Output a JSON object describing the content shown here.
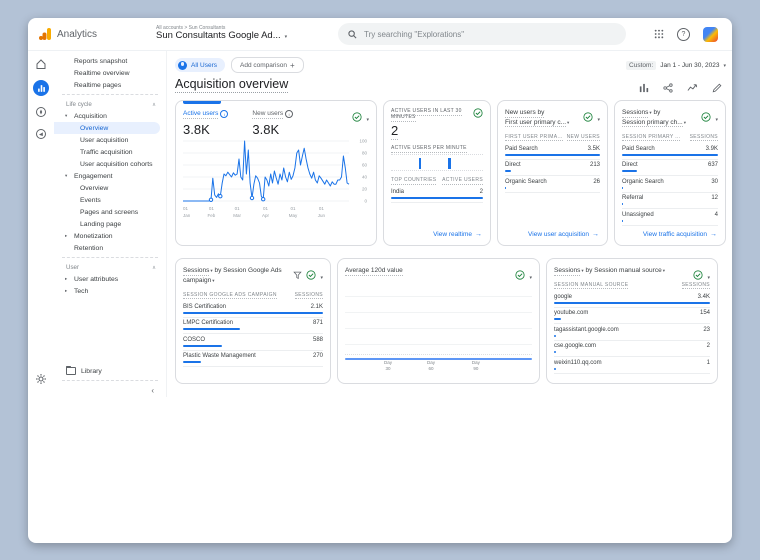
{
  "colors": {
    "accent_blue": "#1a73e8",
    "green_check": "#188038",
    "logo_orange": "#f9ab00",
    "logo_dark_orange": "#e37400",
    "chip_bg": "#e8f0fe",
    "border": "#dadce0"
  },
  "topbar": {
    "product": "Analytics",
    "breadcrumb": "All accounts > Sun Consultants",
    "property": "Sun Consultants Google Ad...",
    "search_placeholder": "Try searching \"Explorations\""
  },
  "sidebar": {
    "rows": [
      {
        "t": "i",
        "label": "Reports snapshot"
      },
      {
        "t": "i",
        "label": "Realtime overview"
      },
      {
        "t": "i",
        "label": "Realtime pages"
      },
      {
        "t": "d"
      },
      {
        "t": "h",
        "label": "Life cycle"
      },
      {
        "t": "i",
        "label": "Acquisition",
        "m": "e"
      },
      {
        "t": "i",
        "label": "Overview",
        "ind": 1,
        "sel": true
      },
      {
        "t": "i",
        "label": "User acquisition",
        "ind": 1
      },
      {
        "t": "i",
        "label": "Traffic acquisition",
        "ind": 1
      },
      {
        "t": "i",
        "label": "User acquisition cohorts",
        "ind": 1
      },
      {
        "t": "i",
        "label": "Engagement",
        "m": "e"
      },
      {
        "t": "i",
        "label": "Overview",
        "ind": 1
      },
      {
        "t": "i",
        "label": "Events",
        "ind": 1
      },
      {
        "t": "i",
        "label": "Pages and screens",
        "ind": 1
      },
      {
        "t": "i",
        "label": "Landing page",
        "ind": 1
      },
      {
        "t": "i",
        "label": "Monetization",
        "m": "c"
      },
      {
        "t": "i",
        "label": "Retention"
      },
      {
        "t": "d"
      },
      {
        "t": "h",
        "label": "User"
      },
      {
        "t": "i",
        "label": "User attributes",
        "m": "c"
      },
      {
        "t": "i",
        "label": "Tech",
        "m": "c"
      }
    ],
    "library": "Library"
  },
  "header": {
    "chip_all": "All Users",
    "chip_add": "Add comparison",
    "date_type": "Custom:",
    "date_range": "Jan 1 - Jun 30, 2023",
    "title": "Acquisition overview"
  },
  "cards": {
    "users_trend": {
      "metrics": [
        {
          "label": "Active users",
          "value": "3.8K"
        },
        {
          "label": "New users",
          "value": "3.8K"
        }
      ],
      "chart": {
        "type": "line",
        "y_ticks": [
          0,
          20,
          40,
          60,
          80,
          100
        ],
        "x_ticks": [
          {
            "f": 0.0,
            "d": "01",
            "m": "Jan"
          },
          {
            "f": 0.171,
            "d": "01",
            "m": "Feb"
          },
          {
            "f": 0.326,
            "d": "01",
            "m": "Mar"
          },
          {
            "f": 0.497,
            "d": "01",
            "m": "Apr"
          },
          {
            "f": 0.663,
            "d": "01",
            "m": "May"
          },
          {
            "f": 0.834,
            "d": "01",
            "m": "Jun"
          }
        ],
        "values": [
          0,
          0,
          0,
          0,
          0,
          0,
          0,
          0,
          0,
          0,
          0,
          0,
          0,
          0,
          0,
          2,
          38,
          10,
          6,
          12,
          8,
          30,
          45,
          42,
          48,
          44,
          40,
          47,
          43,
          45,
          70,
          40,
          35,
          100,
          45,
          85,
          30,
          5,
          28,
          42,
          38,
          30,
          8,
          3,
          40,
          35,
          25,
          45,
          30,
          50,
          38,
          28,
          45,
          35,
          55,
          40,
          32,
          48,
          36,
          42,
          55,
          80,
          85,
          60,
          75,
          88,
          70,
          55,
          45,
          38,
          48,
          35,
          30,
          42,
          38,
          33,
          28,
          35,
          30,
          25,
          32,
          28,
          28,
          35,
          35,
          40,
          75,
          55,
          30,
          28
        ],
        "markers": [
          15,
          20,
          37,
          43
        ]
      }
    },
    "realtime": {
      "title": "ACTIVE USERS IN LAST 30 MINUTES",
      "value": "2",
      "per_minute_label": "ACTIVE USERS PER MINUTE",
      "bars": [
        {
          "f": 0.3
        },
        {
          "f": 0.62
        }
      ],
      "col_countries": "TOP COUNTRIES",
      "col_active": "ACTIVE USERS",
      "rows": [
        {
          "label": "India",
          "value": "2",
          "frac": 1
        }
      ],
      "link": "View realtime"
    },
    "new_users": {
      "line1": "New users by",
      "line2": "First user primary c...",
      "h1": "FIRST USER PRIMA...",
      "h2": "NEW USERS",
      "rows": [
        {
          "label": "Paid Search",
          "value": "3.5K",
          "frac": 1
        },
        {
          "label": "Direct",
          "value": "213",
          "frac": 0.06
        },
        {
          "label": "Organic Search",
          "value": "26",
          "frac": 0.015
        }
      ],
      "link": "View user acquisition"
    },
    "channel": {
      "pre": "Sessions",
      "post": "by",
      "line2": "Session primary ch...",
      "h1": "SESSION PRIMARY ...",
      "h2": "SESSIONS",
      "rows": [
        {
          "label": "Paid Search",
          "value": "3.9K",
          "frac": 1
        },
        {
          "label": "Direct",
          "value": "637",
          "frac": 0.16
        },
        {
          "label": "Organic Search",
          "value": "30",
          "frac": 0.015
        },
        {
          "label": "Referral",
          "value": "12",
          "frac": 0.01
        },
        {
          "label": "Unassigned",
          "value": "4",
          "frac": 0.008
        }
      ],
      "link": "View traffic acquisition"
    },
    "campaign": {
      "pre": "Sessions",
      "post": "by Session Google Ads campaign",
      "h1": "SESSION GOOGLE ADS CAMPAIGN",
      "h2": "SESSIONS",
      "rows": [
        {
          "label": "BIS Certification",
          "value": "2.1K",
          "frac": 1
        },
        {
          "label": "LMPC Certification",
          "value": "871",
          "frac": 0.41
        },
        {
          "label": "COSCO",
          "value": "588",
          "frac": 0.28
        },
        {
          "label": "Plastic Waste Management",
          "value": "270",
          "frac": 0.13
        }
      ]
    },
    "avg": {
      "title": "Average 120d value",
      "ticks": [
        {
          "f": 0.23,
          "d": "Day",
          "n": "30"
        },
        {
          "f": 0.46,
          "d": "Day",
          "n": "60"
        },
        {
          "f": 0.7,
          "d": "Day",
          "n": "90"
        }
      ]
    },
    "source": {
      "pre": "Sessions",
      "post": "by Session manual source",
      "h1": "SESSION MANUAL SOURCE",
      "h2": "SESSIONS",
      "rows": [
        {
          "label": "google",
          "value": "3.4K",
          "frac": 1
        },
        {
          "label": "youtube.com",
          "value": "154",
          "frac": 0.045
        },
        {
          "label": "tagassistant.google.com",
          "value": "23",
          "frac": 0.012
        },
        {
          "label": "cse.google.com",
          "value": "2",
          "frac": 0.006
        },
        {
          "label": "weixin110.qq.com",
          "value": "1",
          "frac": 0.004
        }
      ]
    }
  }
}
